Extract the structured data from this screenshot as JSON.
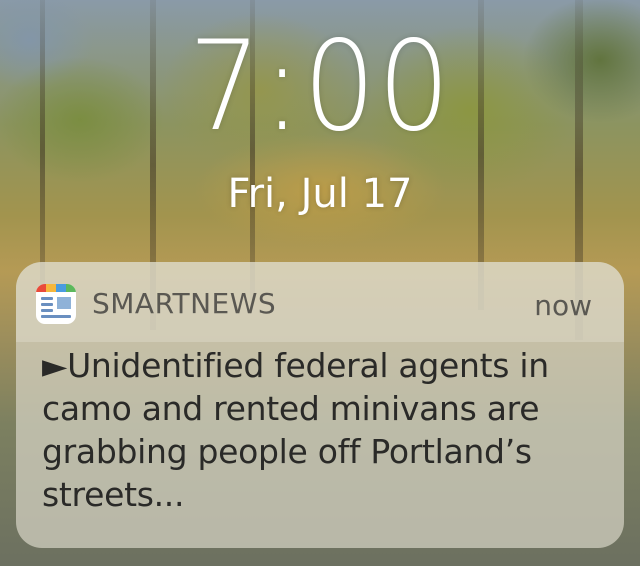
{
  "lock_screen": {
    "time": "7:00",
    "date": "Fri, Jul 17"
  },
  "notification": {
    "app_icon": "smartnews-app-icon",
    "app_name": "SMARTNEWS",
    "timestamp": "now",
    "message": "►Unidentified federal agents in camo and rented minivans are grabbing people off Portland’s streets..."
  },
  "colors": {
    "text_primary": "#ffffff",
    "notification_background": "#d6d2c4",
    "notification_text": "#2a2a28",
    "header_text": "#5a5852"
  }
}
